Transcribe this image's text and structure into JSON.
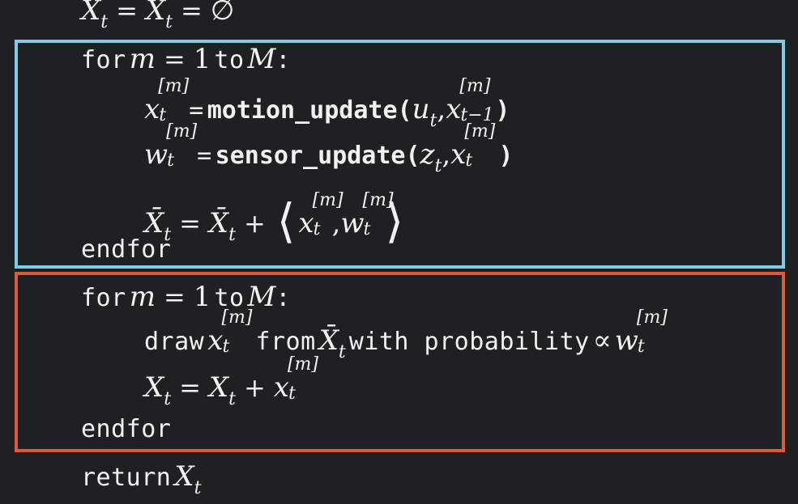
{
  "top_line": {
    "lhs": "X",
    "lhs_sub": "t",
    "mid": "X",
    "mid_sub": "t",
    "rhs": "∅"
  },
  "loop1": {
    "for_kw": "for",
    "var": "m",
    "eq": "=",
    "start": "1",
    "to_kw": "to",
    "end": "M",
    "colon": ":",
    "line1": {
      "target": "x",
      "target_sub": "t",
      "target_sup": "[m]",
      "assign": "=",
      "fn": "motion_update(",
      "arg1": "u",
      "arg1_sub": "t",
      "comma": ",",
      "arg2": "x",
      "arg2_sub": "t−1",
      "arg2_sup": "[m]",
      "close": ")"
    },
    "line2": {
      "target": "w",
      "target_sub": "t",
      "target_sup": "[m]",
      "assign": "=",
      "fn": "sensor_update(",
      "arg1": "z",
      "arg1_sub": "t",
      "comma": ",",
      "arg2": "x",
      "arg2_sub": "t",
      "arg2_sup": "[m]",
      "close": ")"
    },
    "line3": {
      "lhs": "X̄",
      "lhs_sub": "t",
      "eq": "=",
      "rhs": "X̄",
      "rhs_sub": "t",
      "plus": "+",
      "langle": "⟨",
      "a": "x",
      "a_sub": "t",
      "a_sup": "[m]",
      "comma": ",",
      "b": "w",
      "b_sub": "t",
      "b_sup": "[m]",
      "rangle": "⟩"
    },
    "endfor": "endfor"
  },
  "loop2": {
    "for_kw": "for",
    "var": "m",
    "eq": "=",
    "start": "1",
    "to_kw": "to",
    "end": "M",
    "colon": ":",
    "line1": {
      "draw_kw": "draw",
      "x": "x",
      "x_sub": "t",
      "x_sup": "[m]",
      "from_kw": "from",
      "set": "X̄",
      "set_sub": "t",
      "with_kw": "with probability",
      "prop": "∝",
      "w": "w",
      "w_sub": "t",
      "w_sup": "[m]"
    },
    "line2": {
      "lhs": "X",
      "lhs_sub": "t",
      "eq": "=",
      "rhs": "X",
      "rhs_sub": "t",
      "plus": "+",
      "x": "x",
      "x_sub": "t",
      "x_sup": "[m]"
    },
    "endfor": "endfor"
  },
  "return_line": {
    "kw": "return",
    "var": "X",
    "var_sub": "t"
  },
  "colors": {
    "background": "#1e2024",
    "text": "#f2f2f2",
    "box_sampling": "#7ecde6",
    "box_resampling": "#e05a3a"
  }
}
